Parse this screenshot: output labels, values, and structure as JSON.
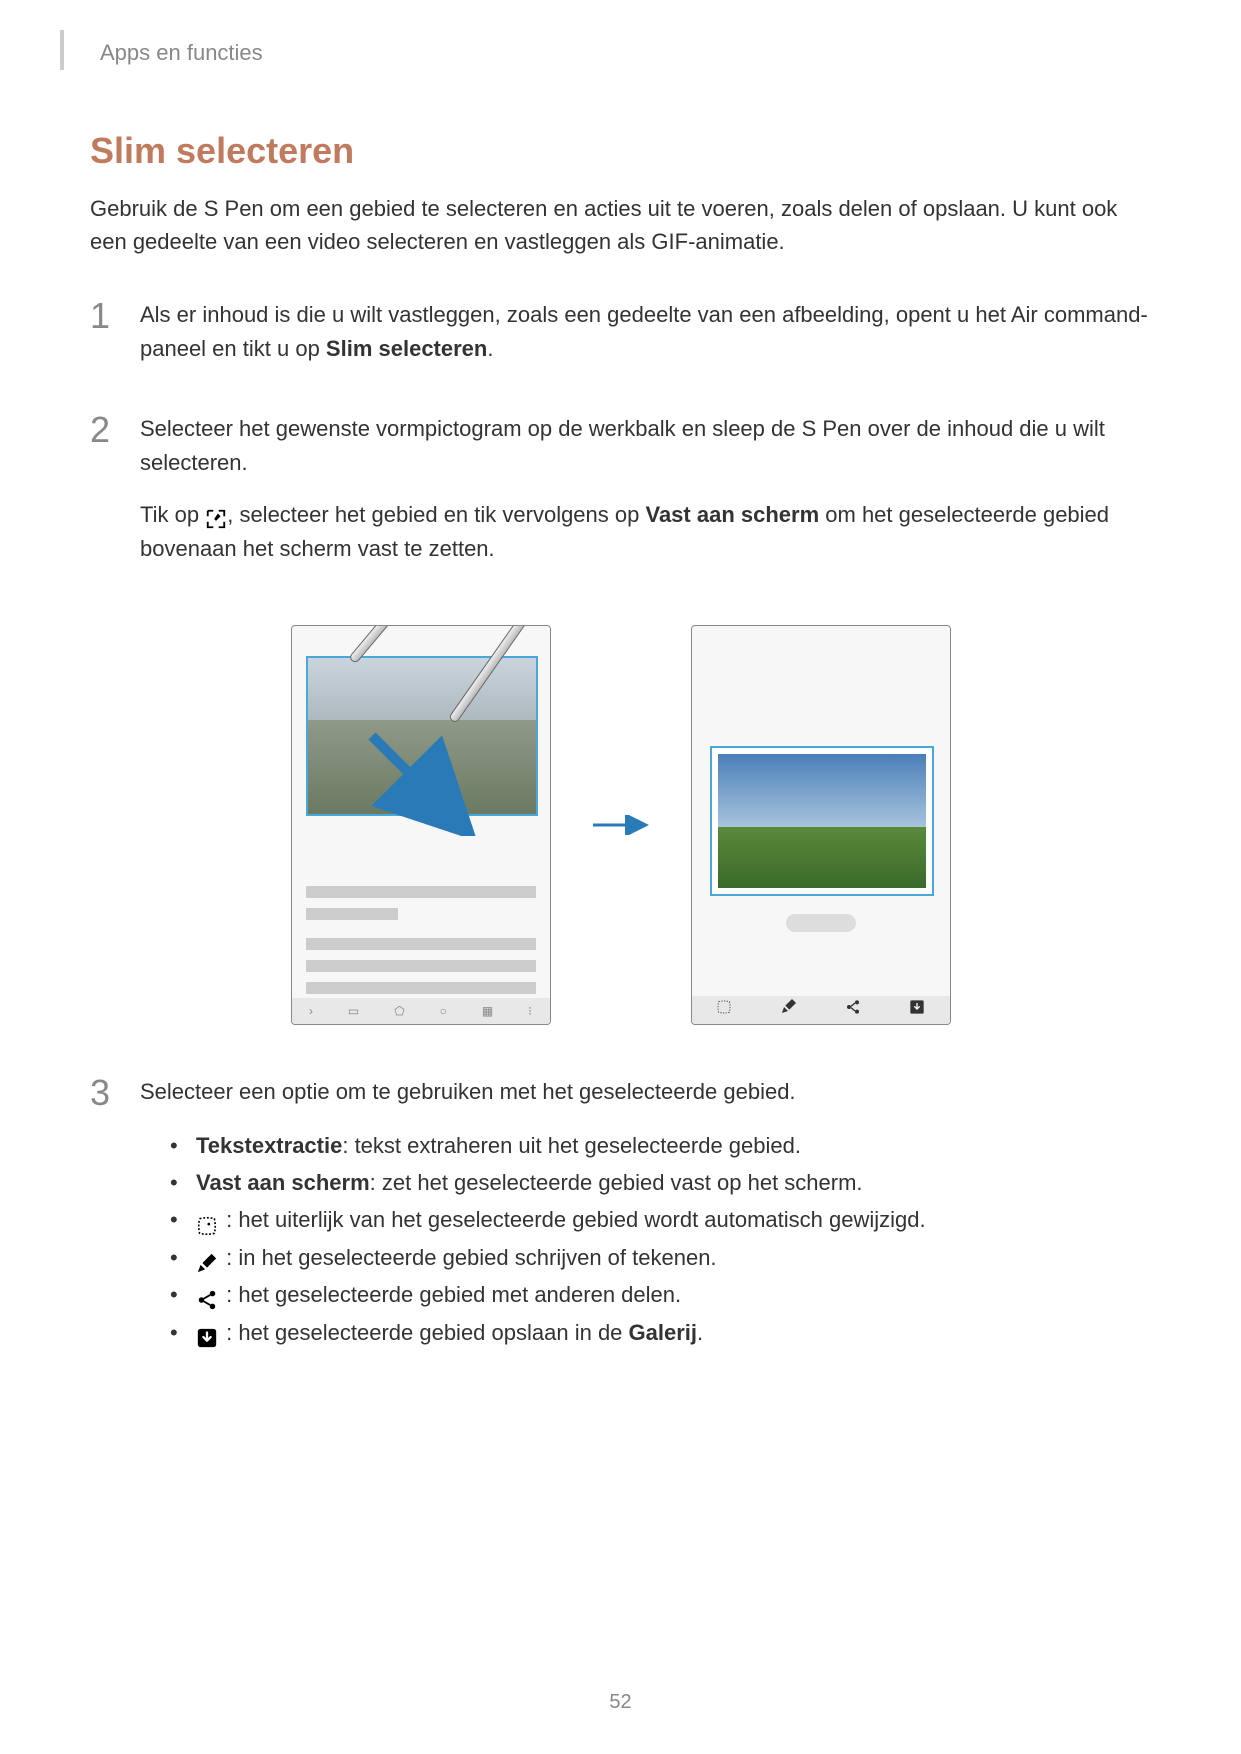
{
  "header": "Apps en functies",
  "title": "Slim selecteren",
  "intro": "Gebruik de S Pen om een gebied te selecteren en acties uit te voeren, zoals delen of opslaan. U kunt ook een gedeelte van een video selecteren en vastleggen als GIF-animatie.",
  "step1": {
    "num": "1",
    "text_a": "Als er inhoud is die u wilt vastleggen, zoals een gedeelte van een afbeelding, opent u het Air command-paneel en tikt u op ",
    "bold": "Slim selecteren",
    "text_b": "."
  },
  "step2": {
    "num": "2",
    "p1": "Selecteer het gewenste vormpictogram op de werkbalk en sleep de S Pen over de inhoud die u wilt selecteren.",
    "p2_a": "Tik op ",
    "p2_b": ", selecteer het gebied en tik vervolgens op ",
    "p2_bold": "Vast aan scherm",
    "p2_c": " om het geselecteerde gebied bovenaan het scherm vast te zetten."
  },
  "step3": {
    "num": "3",
    "text": "Selecteer een optie om te gebruiken met het geselecteerde gebied.",
    "bullets": [
      {
        "bold": "Tekstextractie",
        "rest": ": tekst extraheren uit het geselecteerde gebied."
      },
      {
        "bold": "Vast aan scherm",
        "rest": ": zet het geselecteerde gebied vast op het scherm."
      },
      {
        "icon": "auto",
        "rest": " : het uiterlijk van het geselecteerde gebied wordt automatisch gewijzigd."
      },
      {
        "icon": "draw",
        "rest": " : in het geselecteerde gebied schrijven of tekenen."
      },
      {
        "icon": "share",
        "rest": " : het geselecteerde gebied met anderen delen."
      },
      {
        "icon": "save",
        "rest_a": " : het geselecteerde gebied opslaan in de ",
        "bold2": "Galerij",
        "rest_b": "."
      }
    ]
  },
  "page": "52"
}
